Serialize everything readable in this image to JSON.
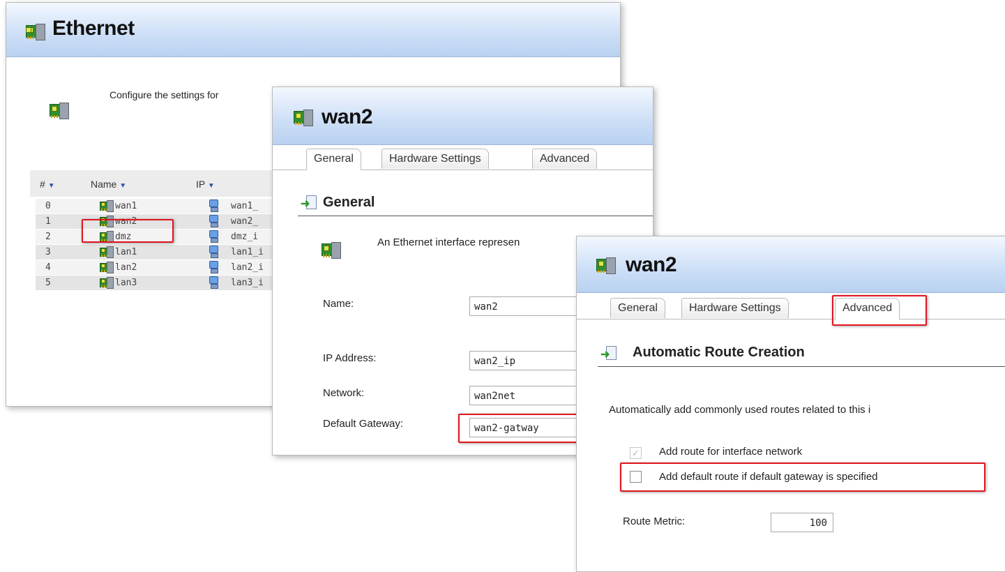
{
  "ethernet_panel": {
    "title": "Ethernet",
    "description": "Configure the settings for",
    "columns": {
      "num": "#",
      "name": "Name",
      "ip": "IP"
    },
    "rows": [
      {
        "idx": "0",
        "name": "wan1",
        "ip": "wan1_"
      },
      {
        "idx": "1",
        "name": "wan2",
        "ip": "wan2_"
      },
      {
        "idx": "2",
        "name": "dmz",
        "ip": "dmz_i"
      },
      {
        "idx": "3",
        "name": "lan1",
        "ip": "lan1_i"
      },
      {
        "idx": "4",
        "name": "lan2",
        "ip": "lan2_i"
      },
      {
        "idx": "5",
        "name": "lan3",
        "ip": "lan3_i"
      }
    ],
    "highlighted_row": "wan2"
  },
  "general_panel": {
    "title": "wan2",
    "tabs": [
      "General",
      "Hardware Settings",
      "Advanced"
    ],
    "active_tab": "General",
    "section": "General",
    "description": "An Ethernet interface represen",
    "fields": {
      "name_label": "Name:",
      "name_value": "wan2",
      "ip_label": "IP Address:",
      "ip_value": "wan2_ip",
      "network_label": "Network:",
      "network_value": "wan2net",
      "gateway_label": "Default Gateway:",
      "gateway_value": "wan2-gatway"
    }
  },
  "advanced_panel": {
    "title": "wan2",
    "tabs": [
      "General",
      "Hardware Settings",
      "Advanced"
    ],
    "active_tab": "Advanced",
    "section": "Automatic Route Creation",
    "description": "Automatically add commonly used routes related to this i",
    "checkboxes": {
      "interface_network_label": "Add route for interface network",
      "interface_network_checked": true,
      "interface_network_disabled": true,
      "default_route_label": "Add default route if default gateway is specified",
      "default_route_checked": false
    },
    "route_metric_label": "Route Metric:",
    "route_metric_value": "100"
  },
  "colors": {
    "highlight_red": "#e0141e",
    "titlebar_blue": "#cfe0f7",
    "icon_green": "#2f8f2f"
  },
  "icons": [
    "network-interface-icon",
    "ip-address-icon",
    "section-arrow-icon",
    "sort-arrow-icon"
  ]
}
